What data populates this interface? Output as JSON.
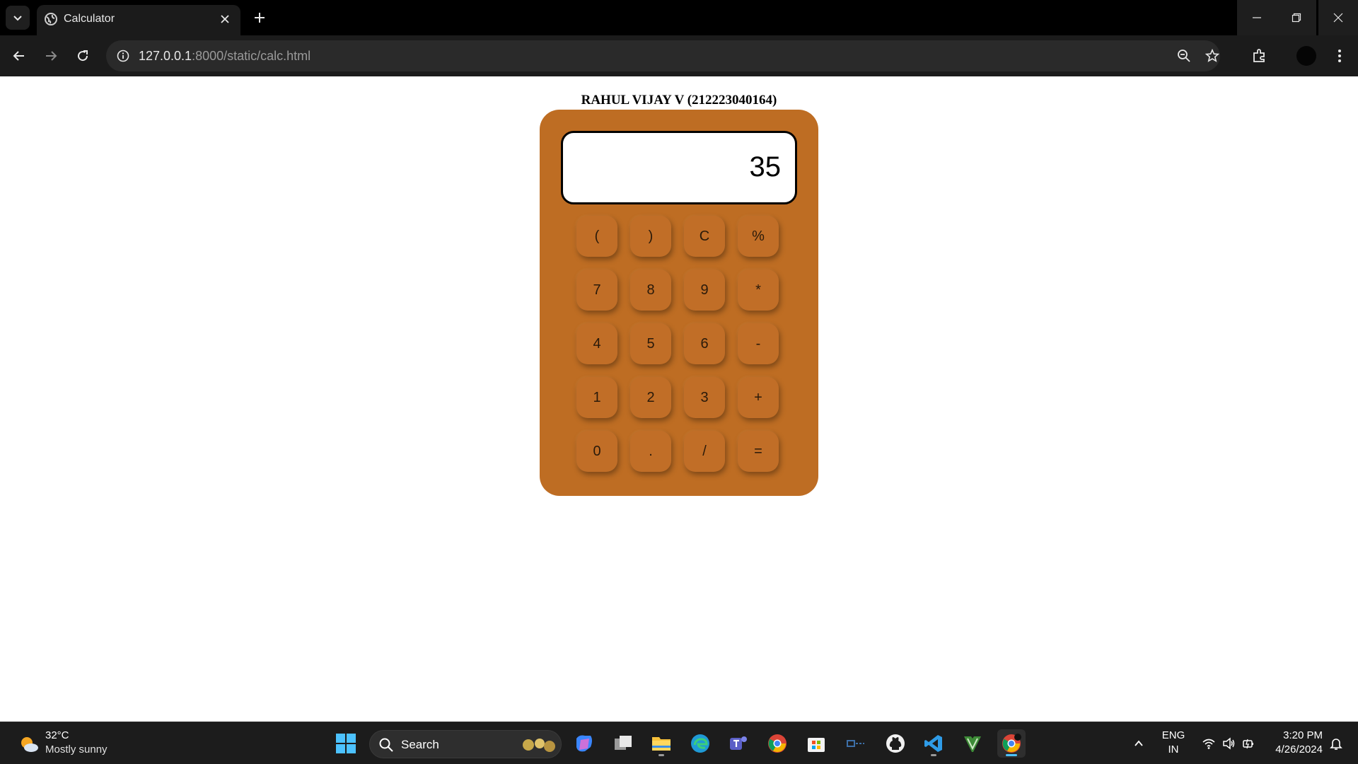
{
  "browser": {
    "tab_title": "Calculator",
    "url_host": "127.0.0.1",
    "url_rest": ":8000/static/calc.html"
  },
  "page": {
    "heading": "RAHUL VIJAY V (212223040164)",
    "display_value": "35",
    "keys": [
      "(",
      ")",
      "C",
      "%",
      "7",
      "8",
      "9",
      "*",
      "4",
      "5",
      "6",
      "-",
      "1",
      "2",
      "3",
      "+",
      "0",
      ".",
      "/",
      "="
    ],
    "colors": {
      "body": "#be6d23",
      "key": "#c16e27",
      "display_bg": "#ffffff"
    }
  },
  "taskbar": {
    "weather_temp": "32°C",
    "weather_desc": "Mostly sunny",
    "search_label": "Search",
    "lang_top": "ENG",
    "lang_bottom": "IN",
    "time": "3:20 PM",
    "date": "4/26/2024"
  }
}
